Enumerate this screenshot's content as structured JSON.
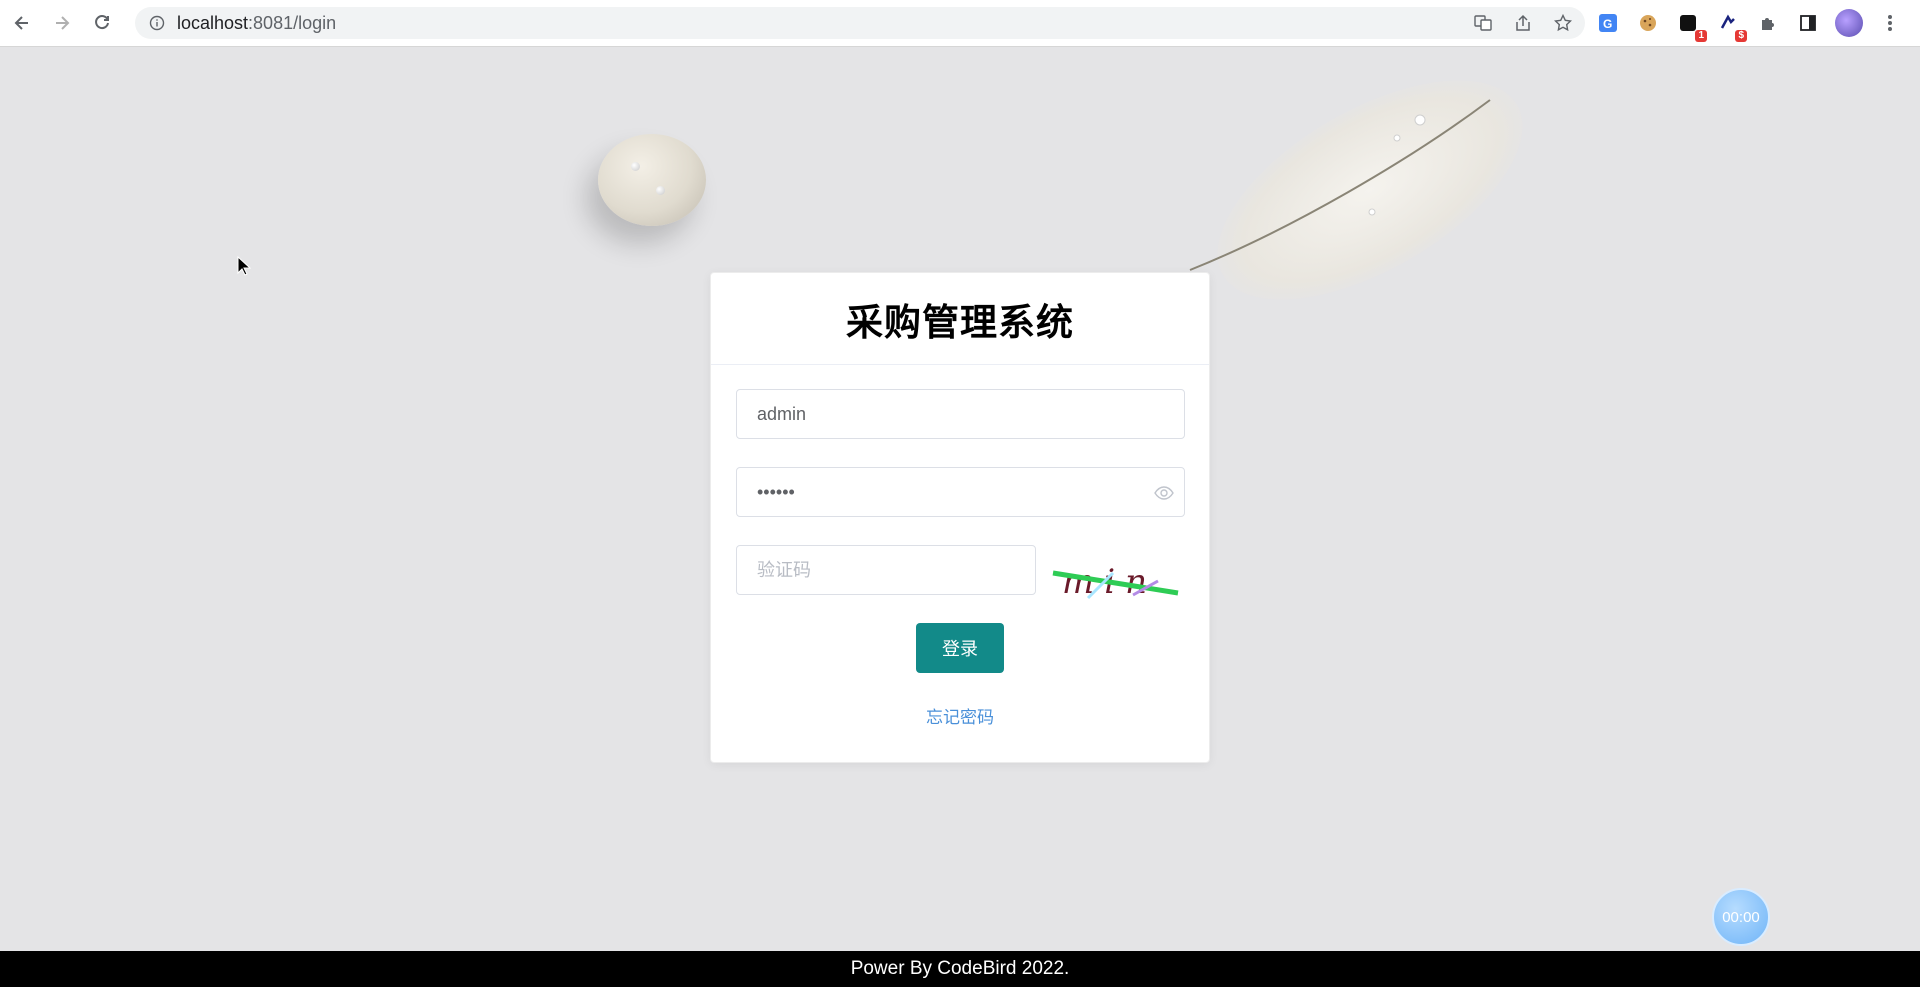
{
  "browser": {
    "url_host": "localhost",
    "url_path": ":8081/login",
    "badges": [
      "1",
      "$"
    ]
  },
  "login": {
    "title": "采购管理系统",
    "username_value": "admin",
    "password_value": "••••••",
    "captcha_placeholder": "验证码",
    "captcha_text": "min",
    "login_label": "登录",
    "forgot_label": "忘记密码"
  },
  "timer": {
    "text": "00:00"
  },
  "footer": {
    "text": "Power By CodeBird 2022."
  },
  "colors": {
    "primary": "#128a89",
    "link": "#4a90d9",
    "background": "#e4e4e6"
  }
}
